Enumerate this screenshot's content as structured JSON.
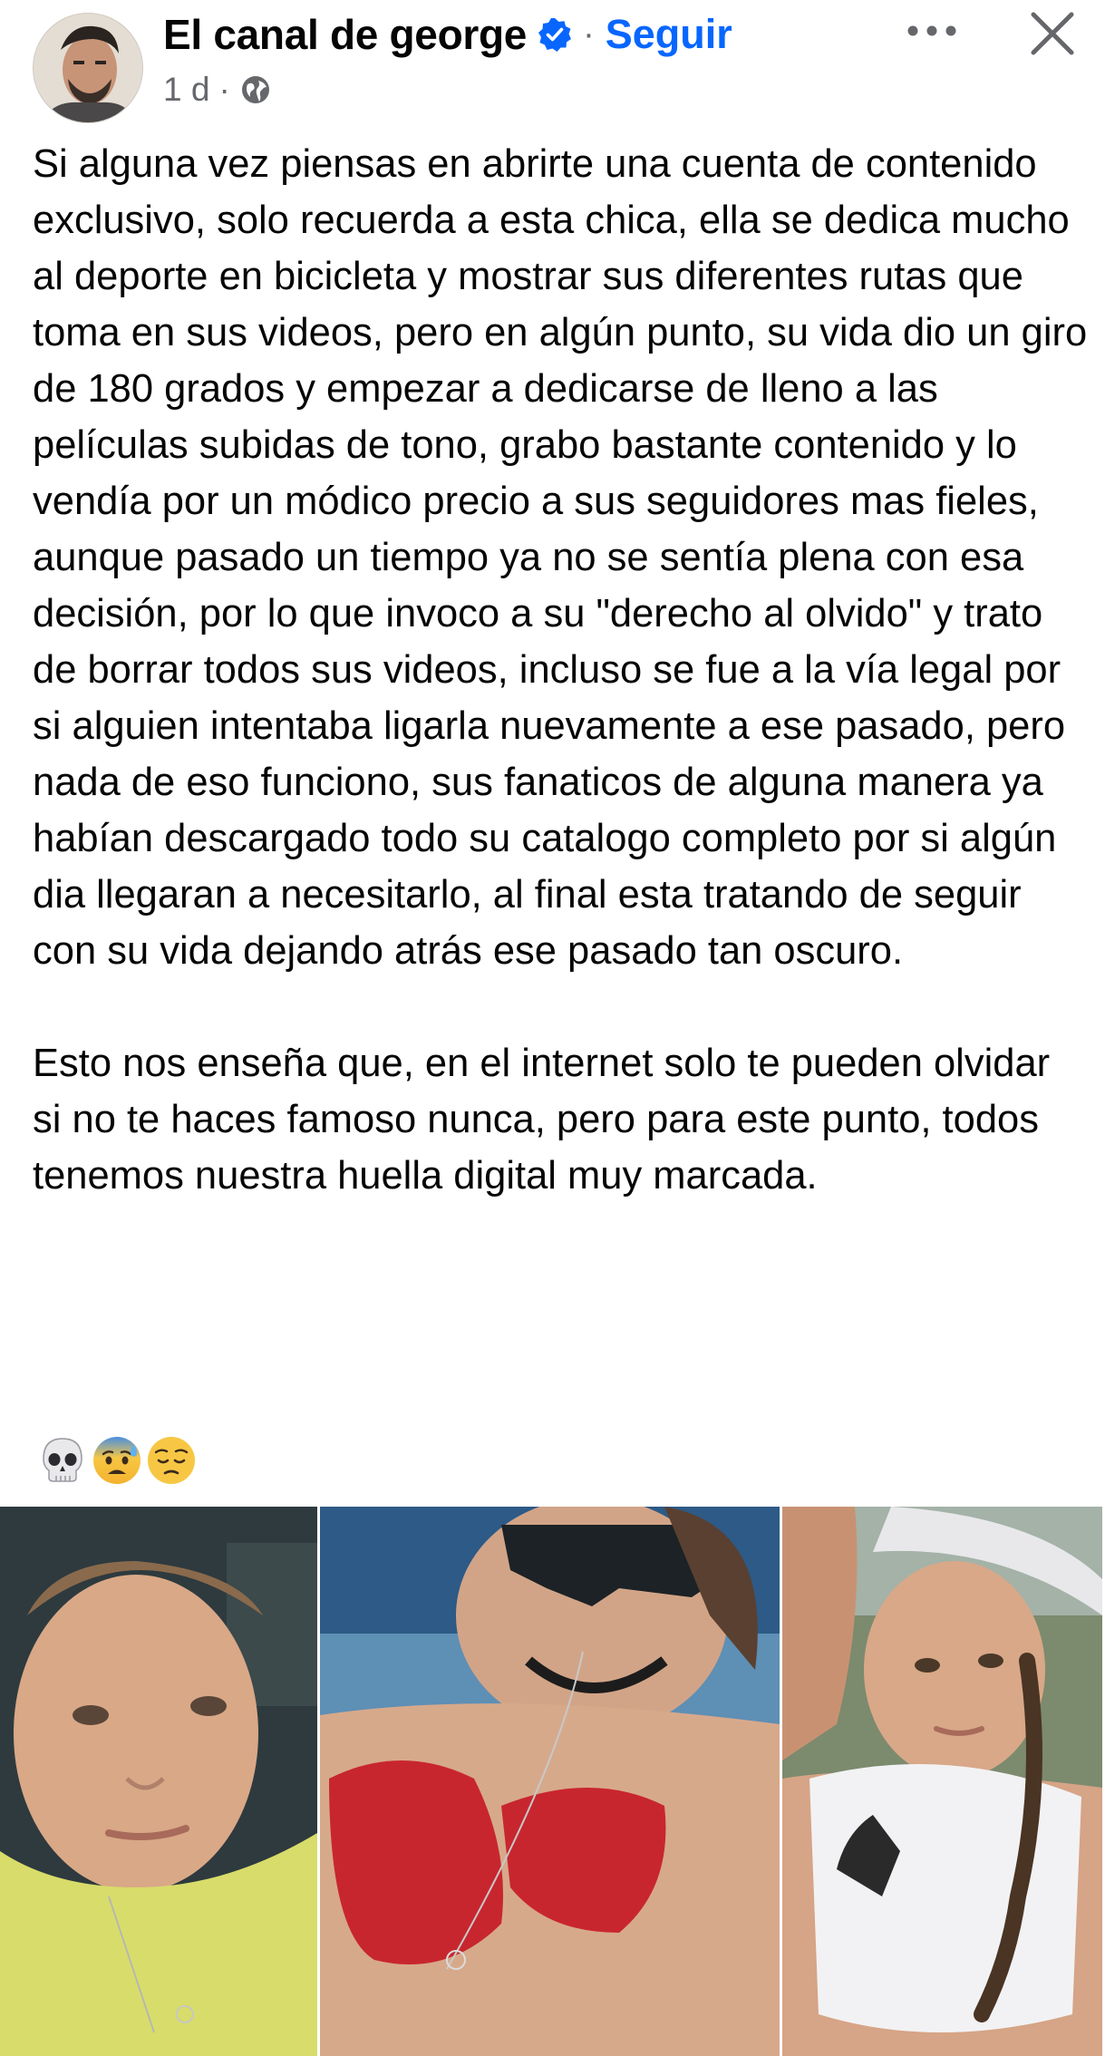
{
  "header": {
    "author_name": "El canal de george",
    "verified_icon": "verified-badge-icon",
    "separator": "·",
    "follow_label": "Seguir",
    "time_ago": "1 d",
    "meta_separator": "·",
    "privacy_icon": "globe-icon",
    "more_icon": "more-options-icon",
    "close_icon": "close-icon"
  },
  "post": {
    "paragraphs": [
      "Si alguna vez piensas en abrirte una cuenta de contenido exclusivo, solo recuerda a esta chica, ella se dedica mucho al deporte en bicicleta y mostrar sus diferentes rutas que toma en sus videos, pero en algún punto, su vida dio un giro de 180 grados y empezar a dedicarse de lleno a las películas subidas de tono, grabo bastante contenido y lo vendía por un módico precio a sus seguidores mas fieles, aunque pasado un tiempo ya no se sentía plena con esa decisión, por lo que invoco a su \"derecho al olvido\" y trato de borrar todos sus videos, incluso se fue a la vía legal por si alguien intentaba ligarla nuevamente a ese pasado, pero nada de eso funciono, sus fanaticos de alguna manera ya habían descargado todo su catalogo completo por si algún dia llegaran a necesitarlo, al final esta tratando de seguir con su vida dejando atrás ese pasado tan oscuro.",
      "Esto nos enseña que, en el internet solo te pueden olvidar si no te haces famoso nunca, pero para este punto, todos tenemos nuestra huella digital muy marcada."
    ],
    "emojis": [
      "skull-emoji",
      "anxious-sweat-emoji",
      "pensive-emoji"
    ]
  },
  "photos": {
    "items": [
      {
        "icon": "photo-selfie-yellow-shirt"
      },
      {
        "icon": "photo-red-top-sunglasses"
      },
      {
        "icon": "photo-white-top-helmet"
      }
    ],
    "colors": {
      "photo1_bg": "#2e3a3e",
      "photo1_shirt": "#d8dc6a",
      "photo2_bg": "#5e8fb5",
      "photo2_top": "#c8262e",
      "photo3_bg": "#7c8a6e",
      "photo3_top": "#f2f2f4"
    }
  },
  "colors": {
    "accent": "#0866ff",
    "text": "#050505",
    "secondary": "#65676b"
  }
}
